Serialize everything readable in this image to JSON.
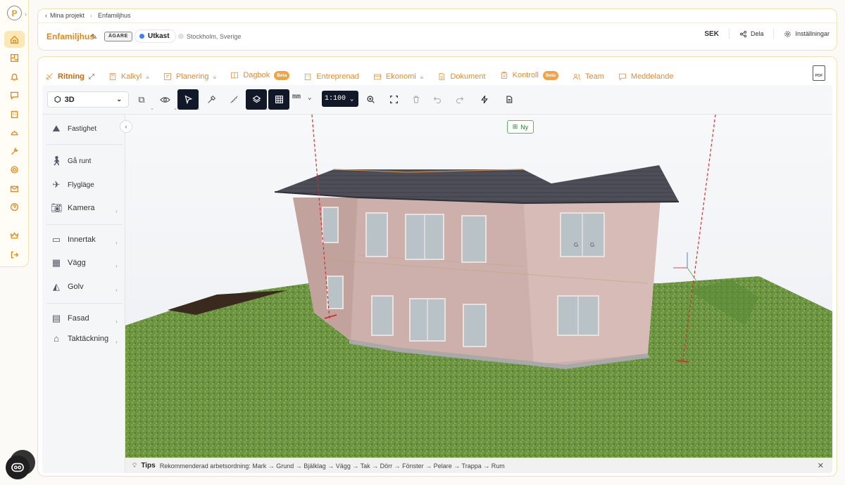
{
  "rail": {
    "logo": "P",
    "items": [
      "home",
      "floorplan",
      "bell",
      "chat",
      "buildings",
      "helmet",
      "tools",
      "settings",
      "mail",
      "help",
      "crown",
      "logout"
    ]
  },
  "header": {
    "breadcrumb_back": "Mina projekt",
    "breadcrumb_current": "Enfamiljhus",
    "project_title": "Enfamiljhus",
    "owner_badge": "ÄGARE",
    "status": "Utkast",
    "location": "Stockholm, Sverige",
    "currency": "SEK",
    "share_label": "Dela",
    "settings_label": "Inställningar"
  },
  "tabs": [
    {
      "label": "Ritning",
      "active": true,
      "locked": false,
      "beta": false
    },
    {
      "label": "Kalkyl",
      "active": false,
      "locked": true,
      "beta": false
    },
    {
      "label": "Planering",
      "active": false,
      "locked": true,
      "beta": false
    },
    {
      "label": "Dagbok",
      "active": false,
      "locked": false,
      "beta": true
    },
    {
      "label": "Entreprenad",
      "active": false,
      "locked": false,
      "beta": false
    },
    {
      "label": "Ekonomi",
      "active": false,
      "locked": true,
      "beta": false
    },
    {
      "label": "Dokument",
      "active": false,
      "locked": false,
      "beta": false
    },
    {
      "label": "Kontroll",
      "active": false,
      "locked": false,
      "beta": true
    },
    {
      "label": "Team",
      "active": false,
      "locked": false,
      "beta": false
    },
    {
      "label": "Meddelande",
      "active": false,
      "locked": false,
      "beta": false
    }
  ],
  "beta_label": "Beta",
  "pdf_label": "PDF",
  "toolbar": {
    "view_mode": "3D",
    "unit": "mm",
    "scale": "1:100"
  },
  "sidebar": {
    "items": [
      {
        "label": "Fastighet",
        "icon": "property-icon"
      },
      {
        "label": "Gå runt",
        "icon": "walk-icon"
      },
      {
        "label": "Flygläge",
        "icon": "fly-icon"
      },
      {
        "label": "Kamera",
        "icon": "camera-icon"
      },
      {
        "label": "Innertak",
        "icon": "ceiling-icon"
      },
      {
        "label": "Vägg",
        "icon": "wall-icon"
      },
      {
        "label": "Golv",
        "icon": "floor-icon"
      },
      {
        "label": "Fasad",
        "icon": "facade-icon"
      },
      {
        "label": "Taktäckning",
        "icon": "roofing-icon"
      }
    ]
  },
  "scene": {
    "new_button": "Ny",
    "window_labels": [
      "G",
      "G"
    ]
  },
  "tips": {
    "title": "Tips",
    "text": "Rekommenderad arbetsordning: Mark → Grund → Bjälklag → Vägg → Tak → Dörr → Fönster → Pelare → Trappa → Rum"
  },
  "colors": {
    "accent": "#e08a17",
    "dark_tool": "#111827",
    "grass": "#5f8a34",
    "wall": "#cfb1ac",
    "roof": "#4a4c55"
  }
}
